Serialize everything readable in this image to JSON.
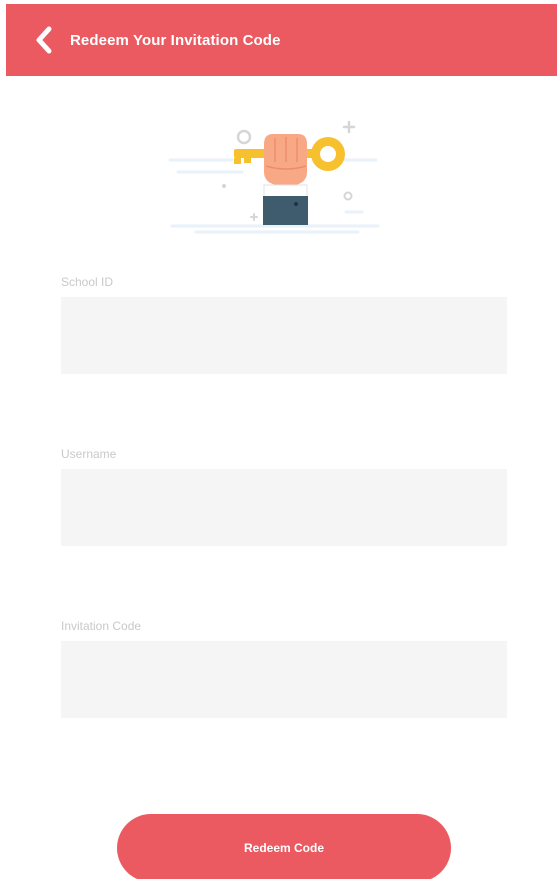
{
  "header": {
    "title": "Redeem Your Invitation Code",
    "back_icon": "chevron-left-icon"
  },
  "illustration": {
    "icon": "hand-holding-key-icon"
  },
  "form": {
    "school_id": {
      "label": "School ID",
      "value": "",
      "placeholder": ""
    },
    "username": {
      "label": "Username",
      "value": "",
      "placeholder": ""
    },
    "invitation_code": {
      "label": "Invitation Code",
      "value": "",
      "placeholder": ""
    }
  },
  "actions": {
    "redeem_label": "Redeem Code"
  },
  "colors": {
    "accent": "#eb5a60",
    "field_bg": "#f5f5f5",
    "label_text": "#c9c9c9"
  }
}
